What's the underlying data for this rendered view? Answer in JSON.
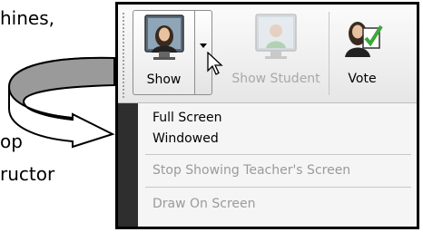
{
  "document": {
    "line1": "hines,",
    "line2": "op",
    "line3": "ructor"
  },
  "toolbar": {
    "buttons": [
      {
        "label": "Show",
        "icon": "teacher-icon",
        "enabled": true
      },
      {
        "label": "Show Student",
        "icon": "student-icon",
        "enabled": false
      },
      {
        "label": "Vote",
        "icon": "vote-icon",
        "enabled": true
      }
    ]
  },
  "menu": {
    "items": [
      {
        "label": "Full Screen",
        "enabled": true
      },
      {
        "label": "Windowed",
        "enabled": true
      },
      {
        "label": "Stop Showing Teacher's Screen",
        "enabled": false
      },
      {
        "label": "Draw On Screen",
        "enabled": false
      }
    ]
  },
  "colors": {
    "menu_strip": "#2e2e2e",
    "disabled_text": "#9a9a9a",
    "vote_check": "#3aa83a"
  }
}
